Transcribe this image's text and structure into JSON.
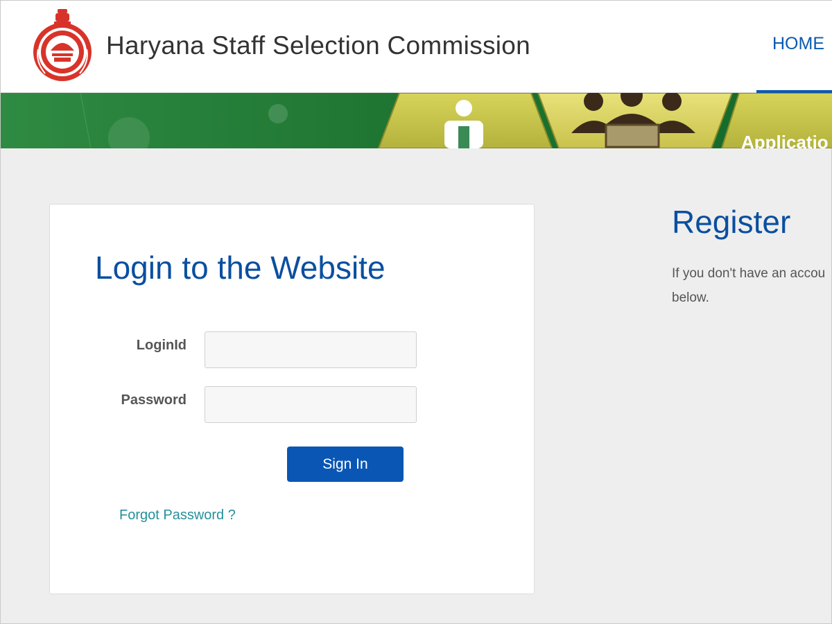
{
  "header": {
    "title": "Haryana Staff Selection Commission",
    "nav": {
      "home_label": "HOME"
    }
  },
  "banner": {
    "partial_text": "Applicatio"
  },
  "login": {
    "title": "Login to the Website",
    "loginid_label": "LoginId",
    "loginid_value": "",
    "password_label": "Password",
    "password_value": "",
    "signin_label": "Sign In",
    "forgot_label": "Forgot Password ?"
  },
  "register": {
    "title": "Register",
    "text_line1": "If you don't have an accou",
    "text_line2": "below."
  },
  "colors": {
    "primary_blue": "#0a56b4",
    "title_blue": "#0a4fa0",
    "link_teal": "#24909a",
    "banner_green": "#1f7a34",
    "banner_yellow": "#c8c64a",
    "emblem_red": "#d8332a"
  }
}
